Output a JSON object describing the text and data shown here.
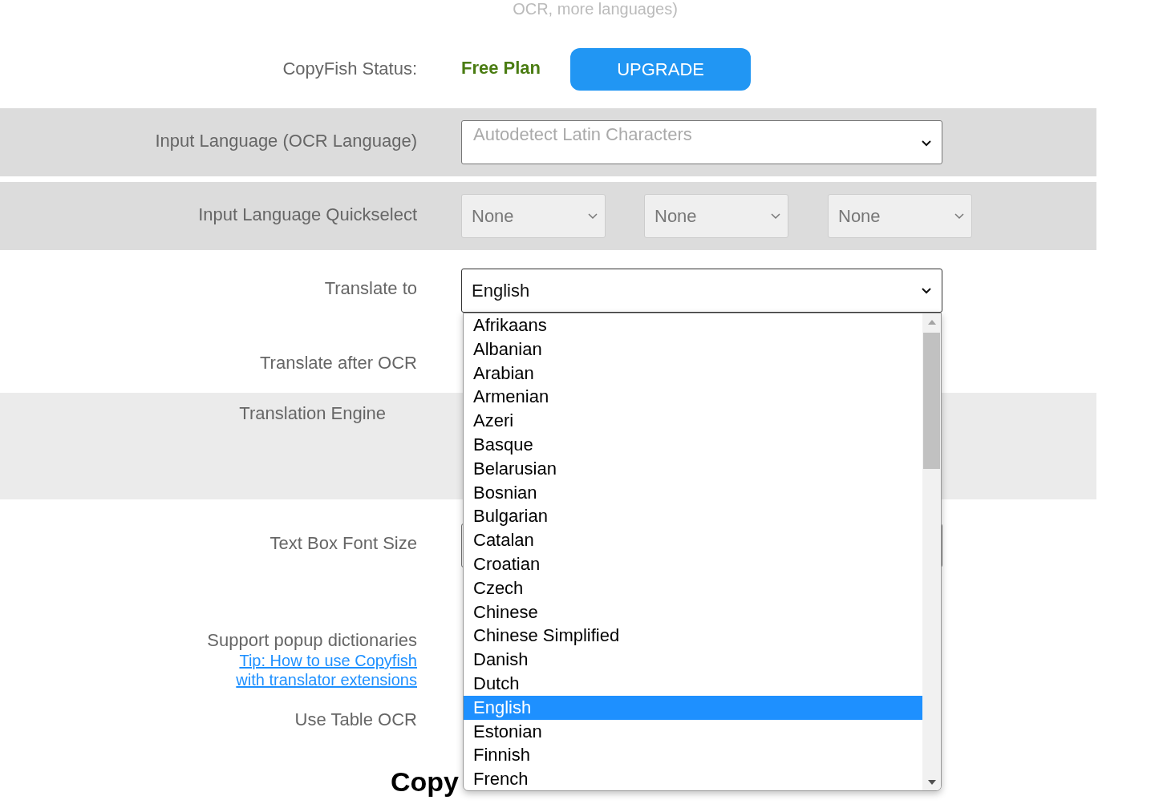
{
  "header_note": "OCR, more languages)",
  "status": {
    "label": "CopyFish Status:",
    "plan": "Free Plan",
    "upgrade_button": "UPGRADE"
  },
  "input_language": {
    "label": "Input Language (OCR Language)",
    "placeholder": "Autodetect Latin Characters"
  },
  "quickselect": {
    "label": "Input Language Quickselect",
    "selects": [
      "None",
      "None",
      "None"
    ]
  },
  "translate_to": {
    "label": "Translate to",
    "value": "English",
    "expanded": true,
    "options": [
      {
        "label": "Afrikaans",
        "selected": false
      },
      {
        "label": "Albanian",
        "selected": false
      },
      {
        "label": "Arabian",
        "selected": false
      },
      {
        "label": "Armenian",
        "selected": false
      },
      {
        "label": "Azeri",
        "selected": false
      },
      {
        "label": "Basque",
        "selected": false
      },
      {
        "label": "Belarusian",
        "selected": false
      },
      {
        "label": "Bosnian",
        "selected": false
      },
      {
        "label": "Bulgarian",
        "selected": false
      },
      {
        "label": "Catalan",
        "selected": false
      },
      {
        "label": "Croatian",
        "selected": false
      },
      {
        "label": "Czech",
        "selected": false
      },
      {
        "label": "Chinese",
        "selected": false
      },
      {
        "label": "Chinese Simplified",
        "selected": false
      },
      {
        "label": "Danish",
        "selected": false
      },
      {
        "label": "Dutch",
        "selected": false
      },
      {
        "label": "English",
        "selected": true
      },
      {
        "label": "Estonian",
        "selected": false
      },
      {
        "label": "Finnish",
        "selected": false
      },
      {
        "label": "French",
        "selected": false
      }
    ]
  },
  "translate_after_ocr": {
    "label": "Translate after OCR"
  },
  "translation_engine": {
    "label": "Translation Engine"
  },
  "text_box_font_size": {
    "label": "Text Box Font Size"
  },
  "popup_dictionaries": {
    "label": "Support popup dictionaries",
    "links": [
      "Tip: How to use Copyfish",
      "with translator extensions"
    ]
  },
  "table_ocr": {
    "label": "Use Table OCR"
  },
  "copy_heading": "Copy"
}
